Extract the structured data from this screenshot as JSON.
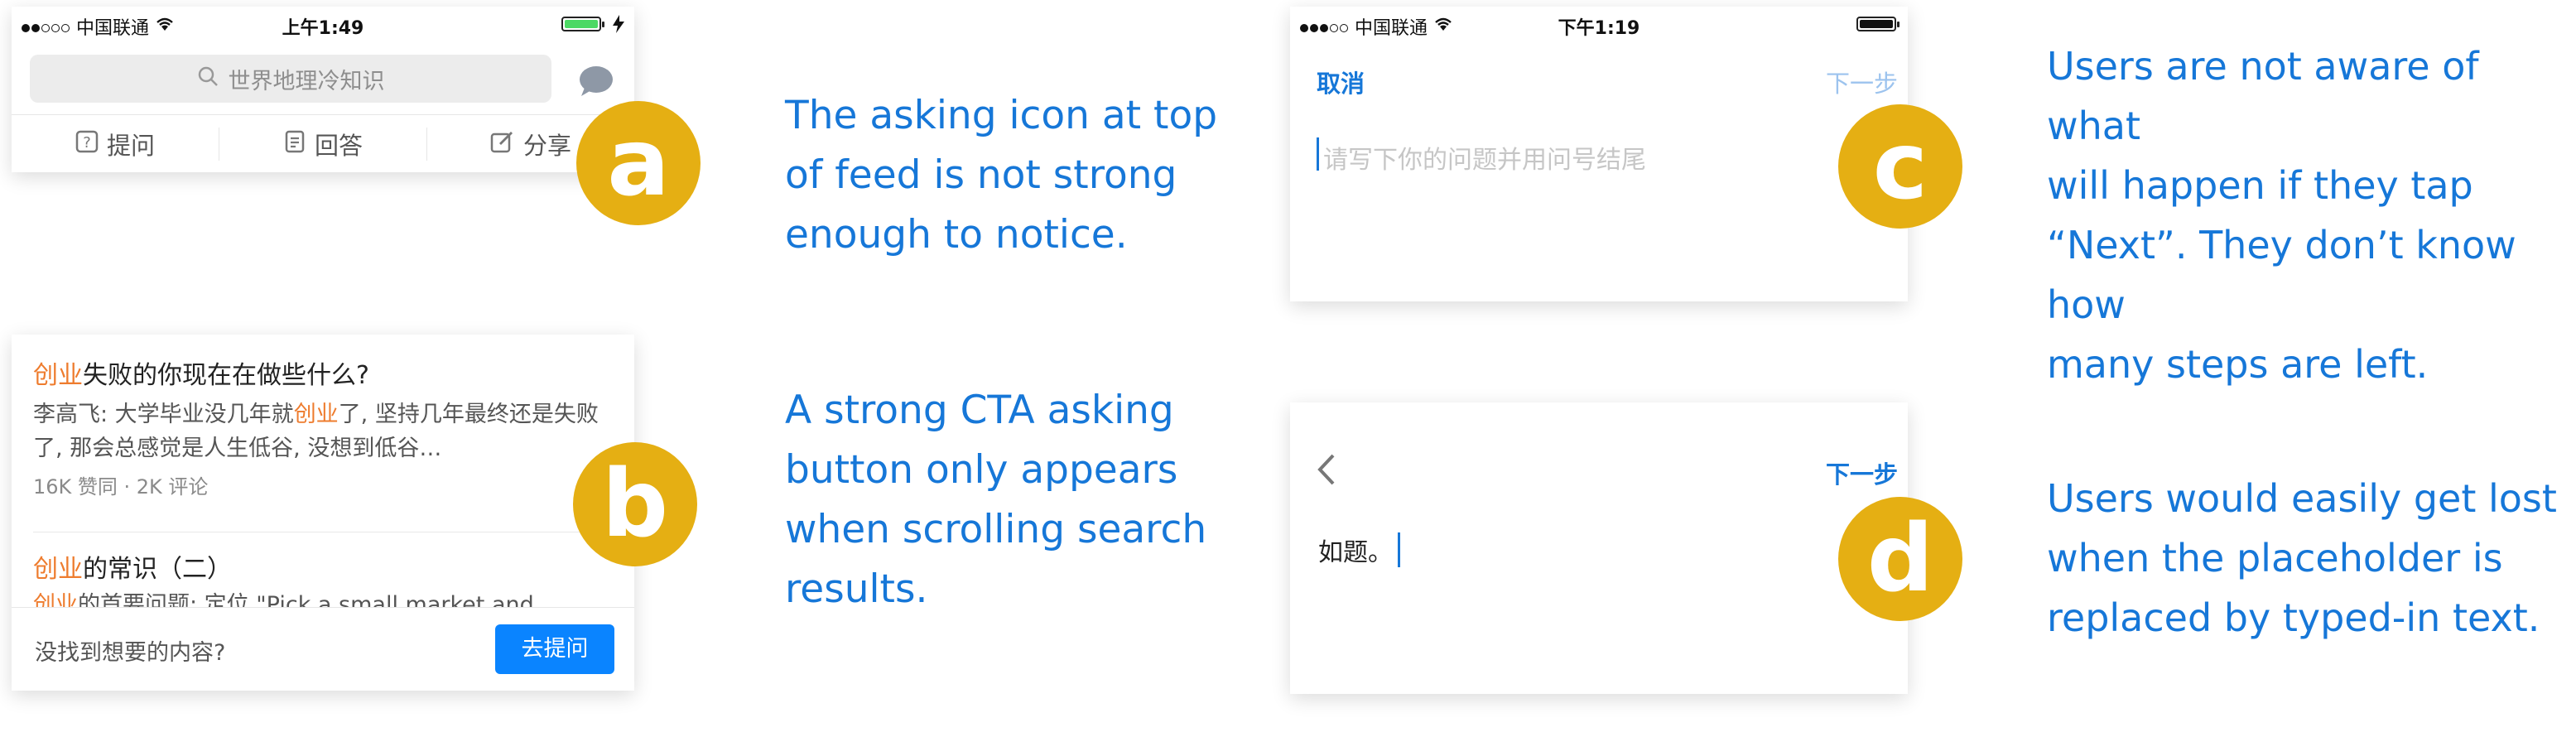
{
  "screen_a": {
    "status": {
      "carrier": "中国联通",
      "time": "上午1:49",
      "battery_color": "#4CD964"
    },
    "search_placeholder": "世界地理冷知识",
    "tabs": [
      {
        "label": "提问",
        "icon": "question-icon"
      },
      {
        "label": "回答",
        "icon": "document-icon"
      },
      {
        "label": "分享",
        "icon": "edit-icon"
      }
    ]
  },
  "screen_b": {
    "results": [
      {
        "highlight": "创业",
        "title_rest": "失败的你现在在做些什么?",
        "snippet_1": "李高飞: 大学毕业没几年就",
        "snippet_hl": "创业",
        "snippet_2": "了, 坚持几年最终还是失败了, 那会总感觉是人生低谷, 没想到低谷…",
        "meta": "16K 赞同 · 2K 评论"
      },
      {
        "highlight": "创业",
        "title_rest": "的常识（二）",
        "snippet_1": "",
        "snippet_hl": "创业",
        "snippet_2": "的首要问题: 定位 \"Pick a small market and",
        "meta": ""
      }
    ],
    "cta_prompt": "没找到想要的内容?",
    "cta_button": "去提问"
  },
  "screen_c": {
    "status": {
      "carrier": "中国联通",
      "time": "下午1:19",
      "battery_color": "#111111"
    },
    "cancel": "取消",
    "next": "下一步",
    "placeholder": "请写下你的问题并用问号结尾"
  },
  "screen_d": {
    "next": "下一步",
    "typed_text": "如题。"
  },
  "badges": {
    "a": "a",
    "b": "b",
    "c": "c",
    "d": "d"
  },
  "notes": {
    "a": "The asking icon at top\nof feed is not strong\nenough to notice.",
    "b": "A strong CTA asking\nbutton only appears\nwhen scrolling search\nresults.",
    "c": "Users are not aware of what\nwill happen if they tap\n“Next”. They don’t know how\nmany steps are left.",
    "d": "Users would easily get lost\nwhen the placeholder is\nreplaced by typed-in text."
  },
  "colors": {
    "accent": "#1677D8",
    "badge": "#E5AF13",
    "highlight": "#EE7C2E",
    "cta": "#0A84FF"
  }
}
